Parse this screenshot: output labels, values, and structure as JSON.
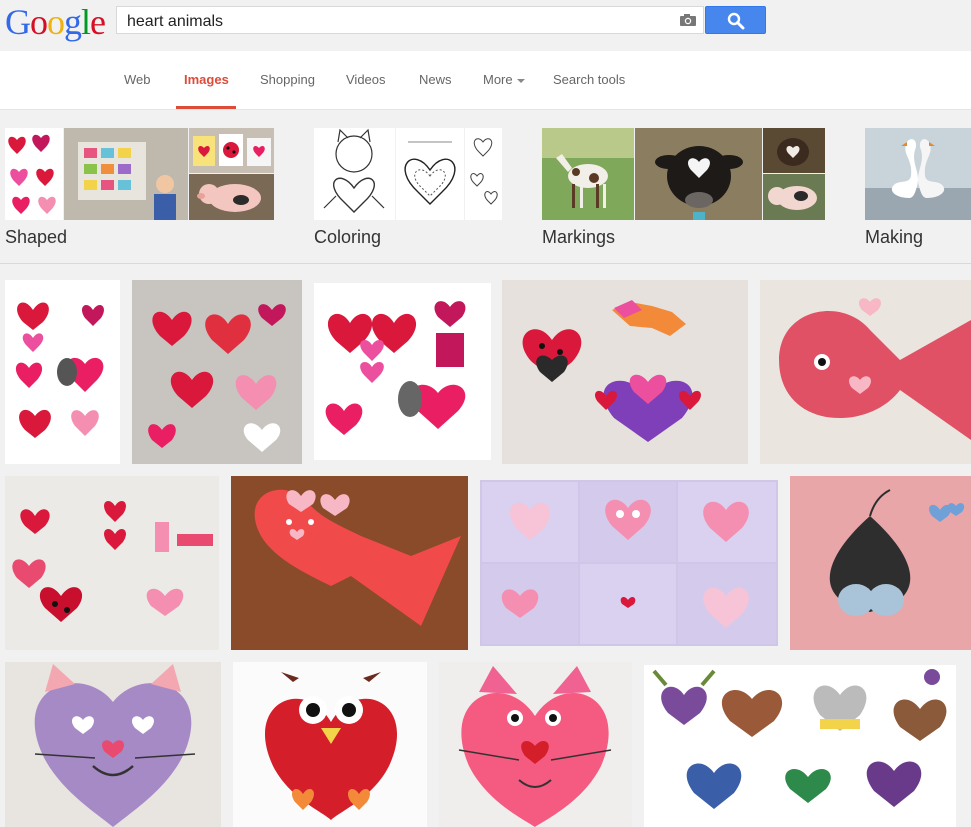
{
  "header": {
    "logo": [
      "G",
      "o",
      "o",
      "g",
      "l",
      "e"
    ],
    "logo_colors": [
      "#3369e8",
      "#d50f25",
      "#eeb211",
      "#3369e8",
      "#009925",
      "#d50f25"
    ],
    "search_value": "heart animals"
  },
  "nav": {
    "items": [
      "Web",
      "Images",
      "Shopping",
      "Videos",
      "News",
      "More",
      "Search tools"
    ],
    "active": "Images"
  },
  "categories": [
    "Shaped",
    "Coloring",
    "Markings",
    "Making"
  ],
  "icons": {
    "camera": "camera-icon",
    "search": "search-icon",
    "caret": "chevron-down-icon"
  },
  "colors": {
    "accent": "#dd4b39",
    "search_button": "#4787ed"
  }
}
